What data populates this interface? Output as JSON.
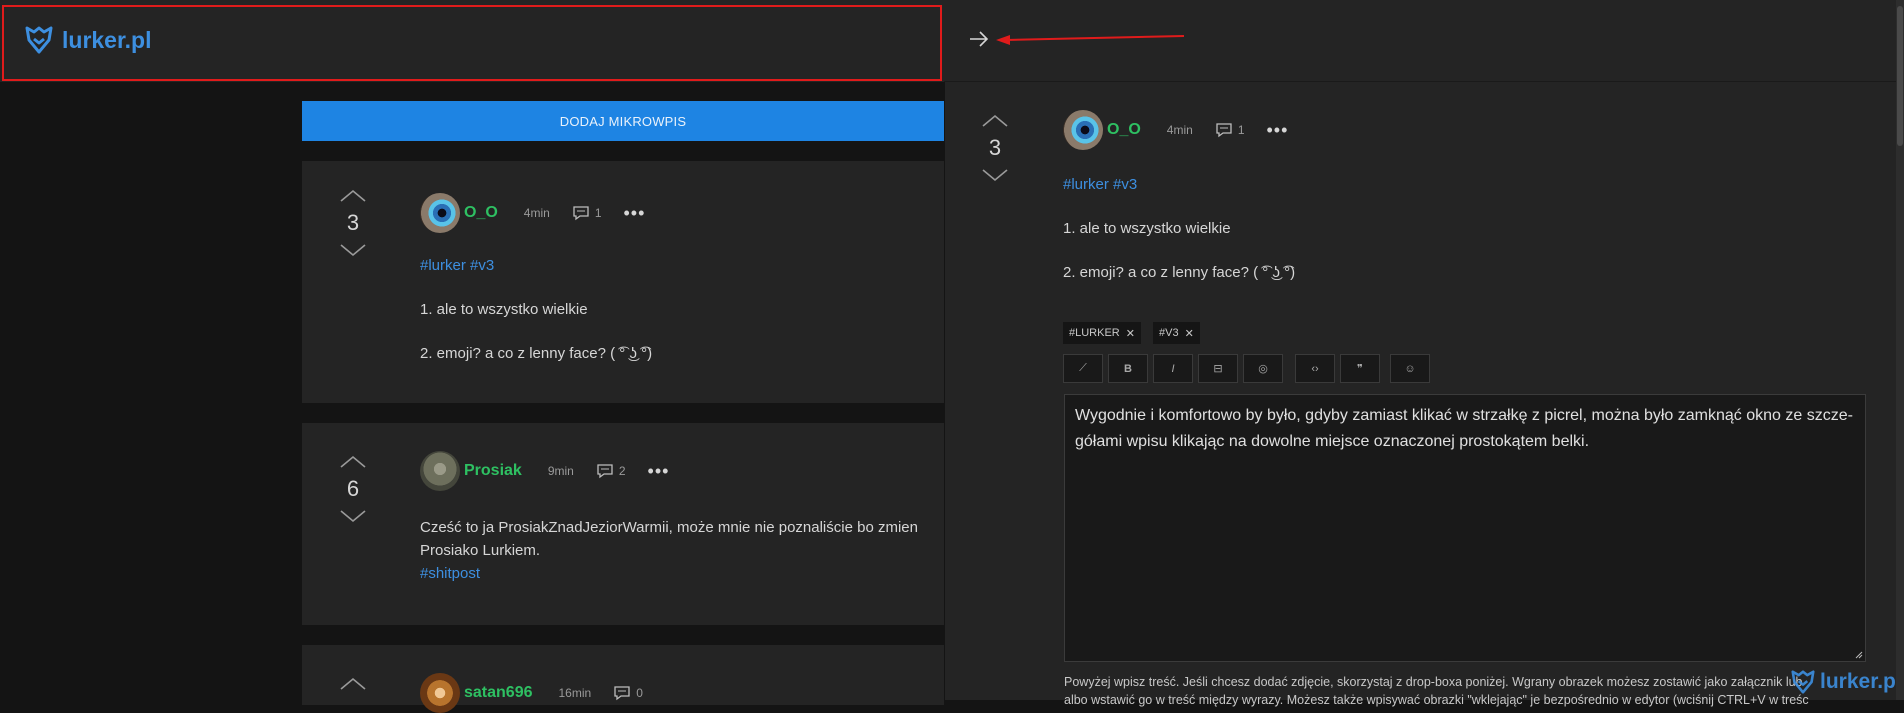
{
  "header": {
    "logo_text": "lurker.pl"
  },
  "feed": {
    "add_button_label": "DODAJ MIKROWPIS",
    "posts": [
      {
        "score": "3",
        "username": "O_O",
        "time": "4min",
        "comment_count": "1",
        "tags": "#lurker #v3",
        "line1": "1. ale to wszystko wielkie",
        "line2": "2. emoji? a co z lenny face? ( ͡° ͜ʖ ͡°)"
      },
      {
        "score": "6",
        "username": "Prosiak",
        "time": "9min",
        "comment_count": "2",
        "line1": "Cześć to ja ProsiakZnadJeziorWarmii, może mnie nie poznaliście bo zmien",
        "line2": "Prosiako Lurkiem.",
        "tag": "#shitpost"
      },
      {
        "username": "satan696",
        "time": "16min",
        "comment_count": "0"
      }
    ]
  },
  "detail": {
    "score": "3",
    "username": "O_O",
    "time": "4min",
    "comment_count": "1",
    "tags": "#lurker #v3",
    "line1": "1. ale to wszystko wielkie",
    "line2": "2. emoji? a co z lenny face? ( ͡° ͜ʖ ͡°)",
    "chips": [
      "#LURKER",
      "#V3"
    ],
    "toolbar": [
      "⟋",
      "B",
      "I",
      "⊟",
      "◎",
      "‹›",
      "❞",
      "☺"
    ],
    "editor_text": "Wygodnie i komfortowo by było, gdyby zamiast klikać w strzałkę z picrel, można było zamknąć okno ze szcze-\ngółami wpisu klikając na dowolne miejsce oznaczonej prostokątem belki.",
    "helper_line1": "Powyżej wpisz treść. Jeśli chcesz dodać zdjęcie, skorzystaj z drop-boxa poniżej. Wgrany obrazek możesz zostawić jako załącznik lub",
    "helper_line2": "albo wstawić go w treść między wyrazy. Możesz także wpisywać obrazki \"wklejając\" je bezpośrednio w edytor (wciśnij CTRL+V w treśc",
    "watermark": "lurker.pl"
  },
  "icons": {
    "logo": "lurker-logo-icon",
    "close": "arrow-right-icon",
    "upvote": "chevron-up-icon",
    "downvote": "chevron-down-icon",
    "comments": "comment-icon",
    "more": "more-dots-icon"
  },
  "colors": {
    "accent_blue": "#1e84e3",
    "link_blue": "#3d8fe0",
    "username_green": "#2ec062",
    "annotation_red": "#e01b1b",
    "panel_bg": "#242424",
    "page_bg": "#141414"
  }
}
